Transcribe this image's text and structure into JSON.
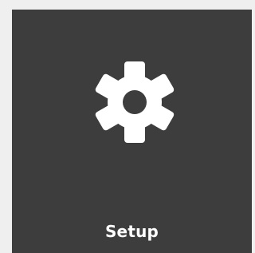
{
  "tile": {
    "label": "Setup",
    "icon": "gear-icon",
    "background_color": "#3d3d3d",
    "foreground_color": "#ffffff"
  }
}
